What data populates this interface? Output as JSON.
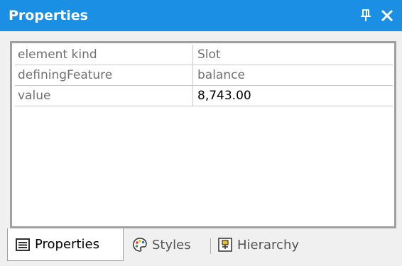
{
  "window": {
    "title": "Properties"
  },
  "properties": {
    "rows": [
      {
        "name": "element kind",
        "value": "Slot"
      },
      {
        "name": "definingFeature",
        "value": "balance"
      },
      {
        "name": "value",
        "value": "8,743.00"
      }
    ]
  },
  "tabs": [
    {
      "label": "Properties",
      "icon": "properties-icon",
      "active": true
    },
    {
      "label": "Styles",
      "icon": "palette-icon",
      "active": false
    },
    {
      "label": "Hierarchy",
      "icon": "hierarchy-icon",
      "active": false
    }
  ],
  "colors": {
    "titlebar": "#1a8fe3",
    "panel_bg": "#f0f0f0",
    "grid_border": "#a0a0a0",
    "readonly_text": "#707070",
    "editable_text": "#000000"
  }
}
